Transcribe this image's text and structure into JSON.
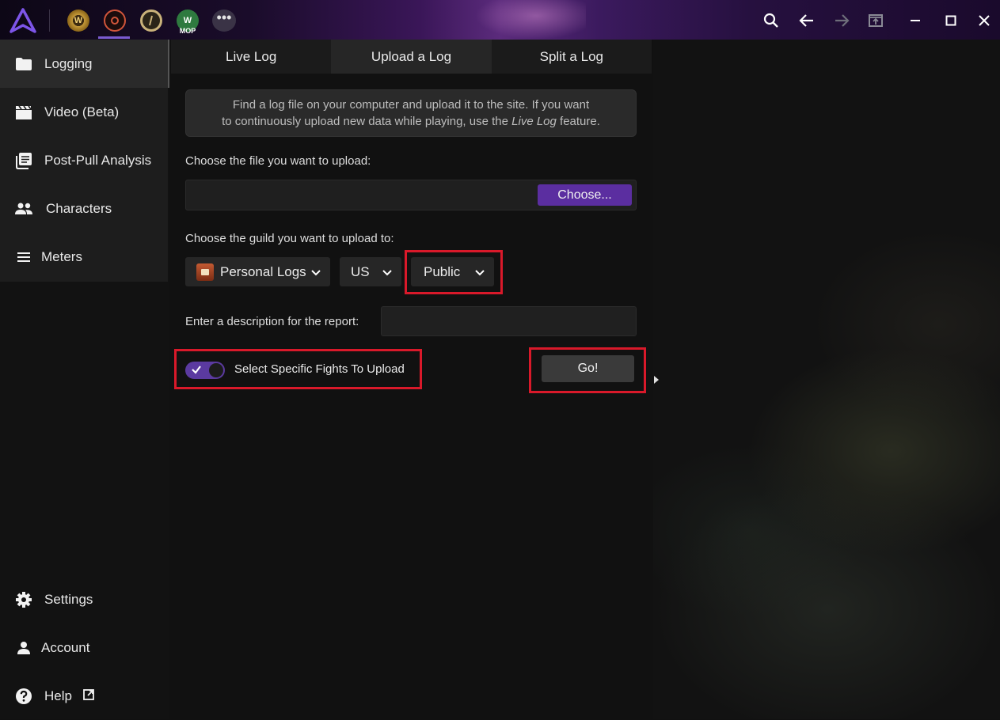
{
  "titlebar": {
    "games": [
      {
        "name": "W"
      },
      {
        "name": ""
      },
      {
        "name": ""
      },
      {
        "name": "W",
        "label": "MOP"
      }
    ],
    "more_label": "•••"
  },
  "sidebar": {
    "items": [
      {
        "label": "Logging",
        "icon": "folder-icon"
      },
      {
        "label": "Video (Beta)",
        "icon": "clapperboard-icon"
      },
      {
        "label": "Post-Pull Analysis",
        "icon": "library-icon"
      },
      {
        "label": "Characters",
        "icon": "people-icon"
      },
      {
        "label": "Meters",
        "icon": "list-icon"
      }
    ],
    "bottom_items": [
      {
        "label": "Settings",
        "icon": "gear-icon"
      },
      {
        "label": "Account",
        "icon": "person-icon"
      },
      {
        "label": "Help",
        "icon": "help-icon"
      }
    ]
  },
  "tabs": [
    {
      "label": "Live Log"
    },
    {
      "label": "Upload a Log"
    },
    {
      "label": "Split a Log"
    }
  ],
  "upload": {
    "info_line1": "Find a log file on your computer and upload it to the site. If you want",
    "info_line2_prefix": "to continuously upload new data while playing, use the ",
    "info_line2_em": "Live Log",
    "info_line2_suffix": " feature.",
    "file_label": "Choose the file you want to upload:",
    "file_value": "",
    "choose_button": "Choose...",
    "guild_label": "Choose the guild you want to upload to:",
    "guild_select": "Personal Logs",
    "region_select": "US",
    "visibility_select": "Public",
    "description_label": "Enter a description for the report:",
    "description_value": "",
    "toggle_label": "Select Specific Fights To Upload",
    "toggle_on": true,
    "go_button": "Go!"
  },
  "colors": {
    "accent": "#5b2ea0",
    "highlight": "#d9192a",
    "panel": "#111111"
  }
}
